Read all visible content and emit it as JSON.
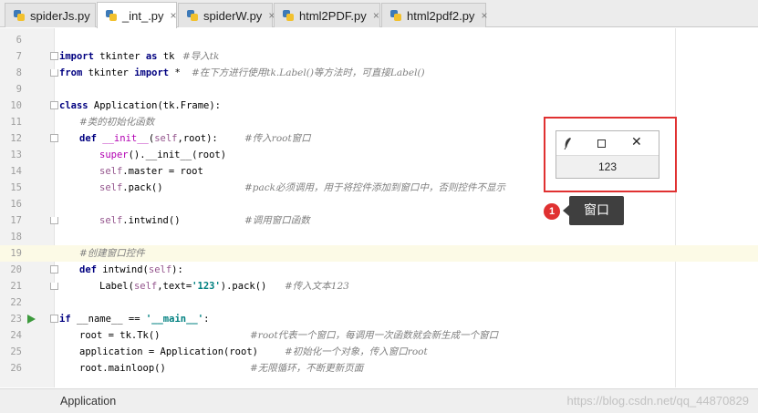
{
  "tabs": [
    {
      "label": "spiderJs.py",
      "close": "×"
    },
    {
      "label": "_int_.py",
      "close": "×"
    },
    {
      "label": "spiderW.py",
      "close": "×"
    },
    {
      "label": "html2PDF.py",
      "close": "×"
    },
    {
      "label": "html2pdf2.py",
      "close": "×"
    }
  ],
  "editor": {
    "lines": [
      {
        "num": "6"
      },
      {
        "num": "7",
        "t1": "import",
        "t2": " tkinter ",
        "t3": "as",
        "t4": " tk",
        "cm": "#导入tk"
      },
      {
        "num": "8",
        "t1": "from",
        "t2": " tkinter ",
        "t3": "import",
        "t4": " *",
        "cm": "#在下方进行使用tk.Label()等方法时，可直接Label()"
      },
      {
        "num": "9"
      },
      {
        "num": "10",
        "t1": "class",
        "t2": " Application(tk.Frame):"
      },
      {
        "num": "11",
        "cm": "#类的初始化函数"
      },
      {
        "num": "12",
        "t1": "def",
        "t2": " __init__",
        "t3": "(",
        "t4": "self",
        "t5": ",root):",
        "cm": "#传入root窗口"
      },
      {
        "num": "13",
        "t1": "super",
        "t2": "().__init__(root)"
      },
      {
        "num": "14",
        "t1": "self",
        "t2": ".master = root"
      },
      {
        "num": "15",
        "t1": "self",
        "t2": ".pack()",
        "cm": "#pack必须调用，用于将控件添加到窗口中，否则控件不显示"
      },
      {
        "num": "16"
      },
      {
        "num": "17",
        "t1": "self",
        "t2": ".intwind()",
        "cm": "#调用窗口函数"
      },
      {
        "num": "18"
      },
      {
        "num": "19",
        "cm": "#创建窗口控件"
      },
      {
        "num": "20",
        "t1": "def",
        "t2": " intwind(",
        "t3": "self",
        "t4": "):"
      },
      {
        "num": "21",
        "t1": "Label(",
        "t2": "self",
        "t3": ",text=",
        "t4": "'123'",
        "t5": ").pack()",
        "cm": "#传入文本123"
      },
      {
        "num": "22"
      },
      {
        "num": "23",
        "t1": "if",
        "t2": " __name__ == ",
        "t3": "'__main__'",
        "t4": ":"
      },
      {
        "num": "24",
        "t1": "root = tk.Tk()",
        "cm": "#root代表一个窗口，每调用一次函数就会新生成一个窗口"
      },
      {
        "num": "25",
        "t1": "application = Application(root)",
        "cm": "#初始化一个对象，传入窗口root"
      },
      {
        "num": "26",
        "t1": "root.mainloop()",
        "cm": "#无限循环，不断更新页面"
      }
    ]
  },
  "preview": {
    "window_label": "123",
    "close_glyph": "✕"
  },
  "callout": {
    "badge": "1",
    "text": "窗口"
  },
  "status": {
    "breadcrumb": "Application",
    "watermark": "https://blog.csdn.net/qq_44870829"
  },
  "colors": {
    "keyword": "#000080",
    "comment": "#808080",
    "self": "#94558d",
    "string": "#008080",
    "highlight_line": "#fcfae6",
    "annotation": "#e03131"
  }
}
